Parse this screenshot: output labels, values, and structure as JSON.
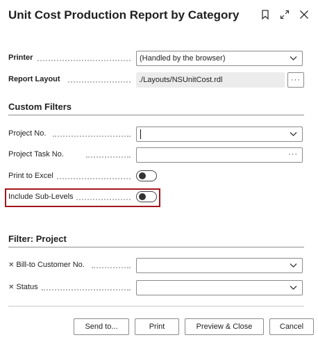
{
  "dialog": {
    "title": "Unit Cost Production Report by Category",
    "icons": [
      "bookmark-icon",
      "expand-icon",
      "close-icon"
    ]
  },
  "options": {
    "printer_label": "Printer",
    "printer_value": "(Handled by the browser)",
    "layout_label": "Report Layout",
    "layout_value": "./Layouts/NSUnitCost.rdl",
    "assist_text": "···"
  },
  "custom_filters": {
    "heading": "Custom Filters",
    "project_no_label": "Project No.",
    "project_no_value": "",
    "project_task_label": "Project Task No.",
    "project_task_value": "",
    "print_excel_label": "Print to Excel",
    "print_excel_on": false,
    "sub_levels_label": "Include Sub-Levels",
    "sub_levels_on": false
  },
  "filter_project": {
    "heading": "Filter: Project",
    "remove_glyph": "✕",
    "bill_to_label": "Bill-to Customer No.",
    "bill_to_value": "",
    "status_label": "Status",
    "status_value": ""
  },
  "footer": {
    "send_to": "Send to...",
    "print": "Print",
    "preview_close": "Preview & Close",
    "cancel": "Cancel"
  },
  "colors": {
    "highlight_border": "#a3151b"
  }
}
